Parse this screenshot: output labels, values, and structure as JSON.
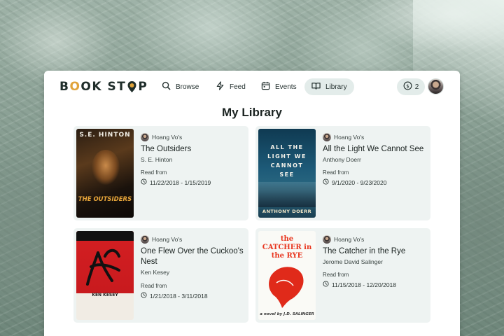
{
  "app": {
    "logo": {
      "part1": "B",
      "part_o": "O",
      "part2": "OK ST",
      "part3": "P"
    }
  },
  "nav": {
    "items": [
      {
        "label": "Browse",
        "icon": "search-icon"
      },
      {
        "label": "Feed",
        "icon": "lightning-icon"
      },
      {
        "label": "Events",
        "icon": "calendar-icon"
      },
      {
        "label": "Library",
        "icon": "book-open-icon",
        "active": true
      }
    ],
    "coins": "2"
  },
  "page": {
    "title": "My Library"
  },
  "library": {
    "read_from_label": "Read from",
    "books": [
      {
        "owner": "Hoang Vo's",
        "title": "The Outsiders",
        "author": "S. E. Hinton",
        "dates": "11/22/2018 - 1/15/2019",
        "cover_top": "S.E. HINTON",
        "cover_bottom": "THE OUTSIDERS"
      },
      {
        "owner": "Hoang Vo's",
        "title": "All the Light We Cannot See",
        "author": "Anthony Doerr",
        "dates": "9/1/2020 - 9/23/2020",
        "cover_top": "ALL THE LIGHT WE CANNOT SEE",
        "cover_bottom": "ANTHONY DOERR"
      },
      {
        "owner": "Hoang Vo's",
        "title": "One Flew Over the Cuckoo's Nest",
        "author": "Ken Kesey",
        "dates": "1/21/2018 - 3/11/2018",
        "cover_top": "",
        "cover_bottom": "KEN KESEY"
      },
      {
        "owner": "Hoang Vo's",
        "title": "The Catcher in the Rye",
        "author": "Jerome David Salinger",
        "dates": "11/15/2018 - 12/20/2018",
        "cover_top": "the CATCHER in the RYE",
        "cover_bottom": "a novel by J.D. SALINGER"
      }
    ]
  },
  "colors": {
    "accent": "#e0a33a",
    "active_bg": "#e3ecea",
    "card_bg": "#eef3f2"
  }
}
